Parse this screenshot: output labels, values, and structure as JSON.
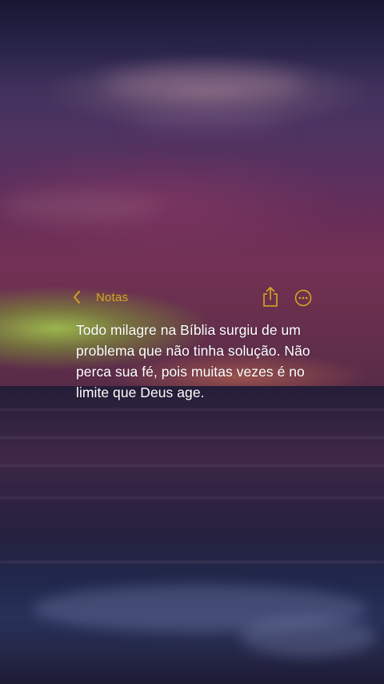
{
  "notes_app": {
    "back_label": "Notas",
    "back_icon": "chevron-left-icon",
    "share_icon": "share-icon",
    "more_icon": "more-options-icon",
    "accent_color": "#d8a81e"
  },
  "note": {
    "text": "Todo milagre na Bíblia surgiu de um problema que não tinha solução. Não perca sua fé, pois muitas vezes é no limite que Deus age."
  },
  "background": {
    "description_colors": {
      "sky_top": "#1c1b38",
      "sky_mid": "#6a3a6e",
      "horizon_glow": "#bee65a",
      "sea": "#2c2848"
    }
  }
}
